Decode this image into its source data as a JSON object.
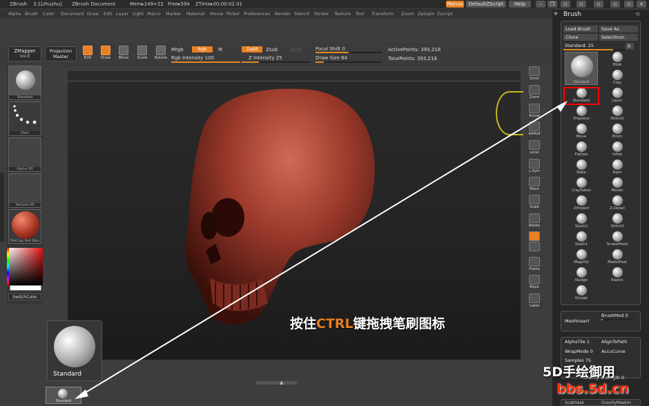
{
  "titlebar": {
    "app": "ZBrush",
    "version": "3.1[zhuzhu]",
    "document": "ZBrush Document",
    "mem": "Mem▸149+22",
    "free": "Free▸594",
    "ztime": "ZTime▸00:00:02.01",
    "menus_btn": "Menus",
    "script_btn": "DefaultZScript",
    "help_btn": "Help"
  },
  "menubar": [
    "Alpha",
    "Brush",
    "Color",
    "Document",
    "Draw",
    "Edit",
    "Layer",
    "Light",
    "Macro",
    "Marker",
    "Material",
    "Movie",
    "Picker",
    "Preferences",
    "Render",
    "Stencil",
    "Stroke",
    "Texture",
    "Tool",
    "Transform",
    "Zoom",
    "Zplugin",
    "Zscript"
  ],
  "toolbar": {
    "zmapper": "ZMapper",
    "zmapper_sub": "rev-E",
    "projection": "Projection",
    "projection_sub": "Master",
    "tools": [
      {
        "label": "Edit",
        "on": true
      },
      {
        "label": "Draw",
        "on": true
      },
      {
        "label": "Move",
        "on": false
      },
      {
        "label": "Scale",
        "on": false
      },
      {
        "label": "Rotate",
        "on": false
      }
    ],
    "mrgb": "Mrgb",
    "rgb": "Rgb",
    "m": "M",
    "rgb_intensity": "Rgb Intensity 100",
    "zadd": "Zadd",
    "zsub": "Zsub",
    "zcut": "Zcut",
    "z_intensity": "Z Intensity 25",
    "focal_shift": "Focal Shift 0",
    "draw_size": "Draw Size 64",
    "active_points": "ActivePoints: 393,218",
    "total_points": "TotalPoints: 393,218",
    "rgb_intensity_value": 1.0,
    "z_intensity_value": 0.25,
    "focal_shift_value": 0.5,
    "draw_size_value": 0.12
  },
  "left": {
    "swatches": [
      "Standard",
      "Dots",
      "Alpha Off",
      "Texture Off",
      "MatCap Red Wax"
    ],
    "switch_color": "SwitchColor"
  },
  "right_tools": [
    "Scroll",
    "Zoom",
    "Actual",
    "AAHalf",
    "Local",
    "L.Sym",
    "Move",
    "Scale",
    "Rotate",
    "XYZ",
    "",
    "Frame",
    "Move",
    "Lasso"
  ],
  "brush_panel": {
    "title": "Brush",
    "load": "Load Brush",
    "save": "Save As",
    "clone": "Clone",
    "select_icon": "SelectIcon",
    "standard": "Standard. 25",
    "r": "R",
    "current": "Standard",
    "brushes": [
      "Blob",
      "Clay",
      "Standard",
      "Layer",
      "Displace",
      "Stitch2",
      "Move",
      "Pinch",
      "Flatten",
      "Inflat",
      "Rake",
      "Ram",
      "ClayTubes",
      "Morph",
      "ZProject",
      "Z-Detail",
      "Slash2",
      "Stitch3",
      "Slash1",
      "SnakeHook",
      "Magnify",
      "MalletFast",
      "Nudge",
      "Elastic",
      "Gouge"
    ]
  },
  "sub_panels": {
    "brushmod": "BrushMod 0",
    "mesh_insert": "MeshInsert",
    "alpha_tile": "AlphaTile 1",
    "align_to_path": "AlignToPath",
    "wrap_mode": "WrapMode 0",
    "accu_curve": "AccuCurve",
    "samples": "Samples 75",
    "gravity": "Gravity Strength 0",
    "bottom_left": "ScatHask",
    "bottom_right": "GravityMaskIn"
  },
  "popup": {
    "label": "Standard"
  },
  "tray": {
    "label": "Standard"
  },
  "annotation": {
    "text_a": "按住",
    "text_ctrl": "CTRL",
    "text_b": "键拖拽笔刷图标"
  },
  "watermark": {
    "line1": "5D手绘御用",
    "line2": "bbs.5d.cn"
  },
  "colors": {
    "accent": "#e87f22",
    "highlight": "#ff0000",
    "skull": "#9c3a2c",
    "watermark_red": "#ff2a00"
  }
}
